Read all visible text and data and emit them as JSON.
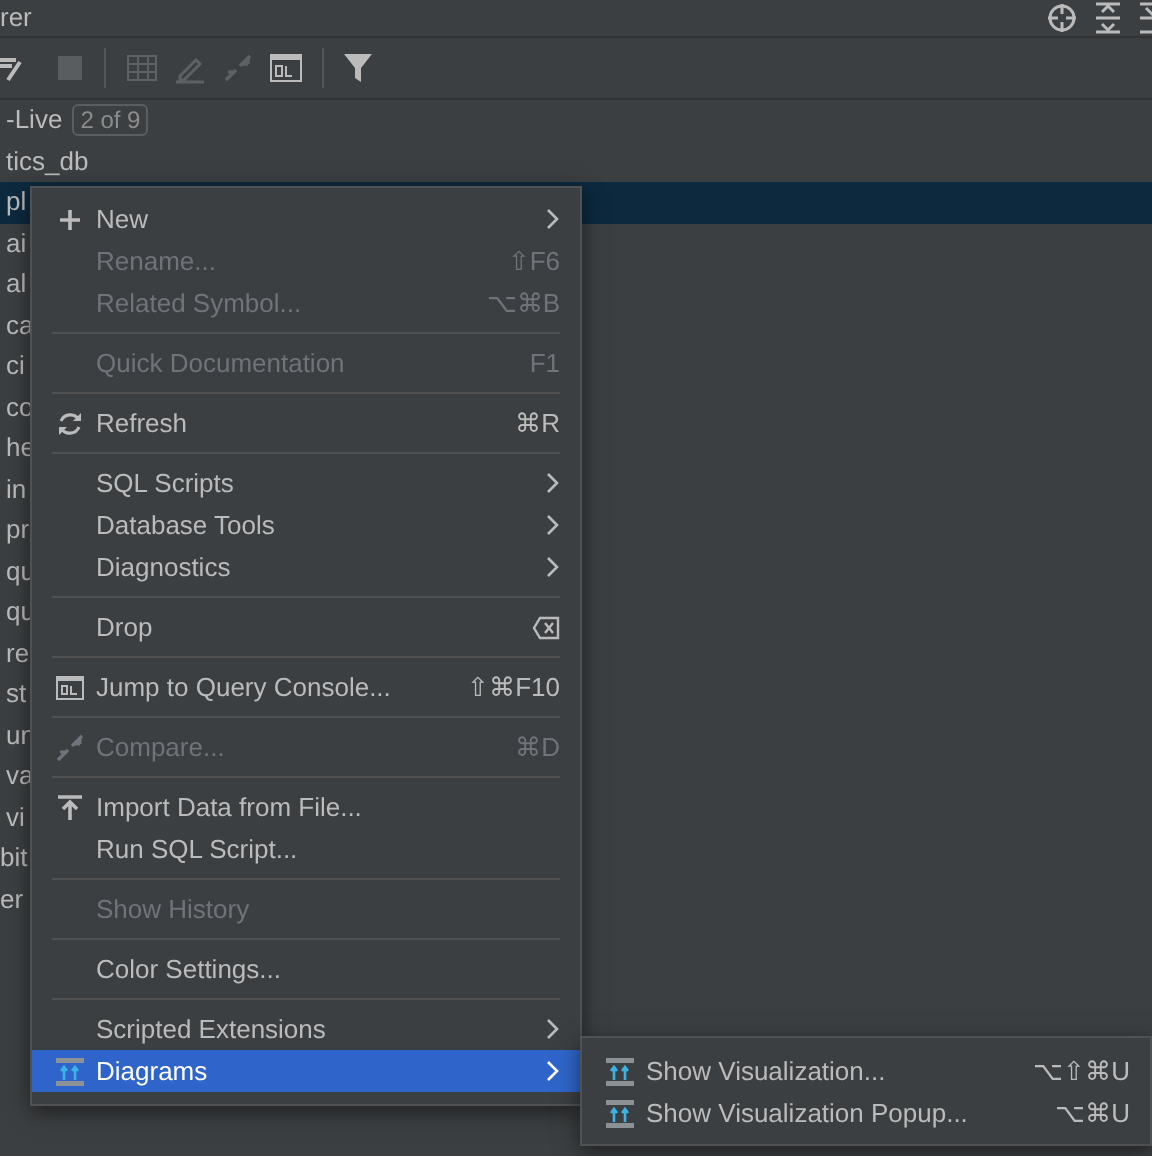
{
  "panel": {
    "title": "rer"
  },
  "tree": [
    {
      "label": "-Live",
      "badge": "2 of 9",
      "selected": false
    },
    {
      "label": "tics_db",
      "selected": false
    },
    {
      "label": "pl",
      "selected": true
    },
    {
      "label": "ai",
      "selected": false
    },
    {
      "label": "al",
      "selected": false
    },
    {
      "label": "ca",
      "selected": false
    },
    {
      "label": "ci",
      "selected": false
    },
    {
      "label": "co",
      "selected": false
    },
    {
      "label": "he",
      "selected": false
    },
    {
      "label": "in",
      "selected": false
    },
    {
      "label": "pr",
      "selected": false
    },
    {
      "label": "qu",
      "selected": false
    },
    {
      "label": "qu",
      "selected": false
    },
    {
      "label": "re",
      "selected": false
    },
    {
      "label": "st",
      "selected": false
    },
    {
      "label": "un",
      "selected": false
    },
    {
      "label": "va",
      "selected": false
    },
    {
      "label": "vi",
      "selected": false
    },
    {
      "label": "bit",
      "selected": false
    },
    {
      "label": "er",
      "selected": false
    }
  ],
  "context_menu": [
    {
      "kind": "item",
      "label": "New",
      "submenu": true,
      "disabled": false,
      "selected": false
    },
    {
      "kind": "item",
      "label": "Rename...",
      "shortcut": "⇧F6",
      "disabled": true,
      "selected": false
    },
    {
      "kind": "item",
      "label": "Related Symbol...",
      "shortcut": "⌥⌘B",
      "disabled": true,
      "selected": false
    },
    {
      "kind": "separator"
    },
    {
      "kind": "item",
      "label": "Quick Documentation",
      "shortcut": "F1",
      "disabled": true,
      "selected": false
    },
    {
      "kind": "separator"
    },
    {
      "kind": "item",
      "label": "Refresh",
      "shortcut": "⌘R",
      "disabled": false,
      "selected": false
    },
    {
      "kind": "separator"
    },
    {
      "kind": "item",
      "label": "SQL Scripts",
      "submenu": true,
      "disabled": false,
      "selected": false
    },
    {
      "kind": "item",
      "label": "Database Tools",
      "submenu": true,
      "disabled": false,
      "selected": false
    },
    {
      "kind": "item",
      "label": "Diagnostics",
      "submenu": true,
      "disabled": false,
      "selected": false
    },
    {
      "kind": "separator"
    },
    {
      "kind": "item",
      "label": "Drop",
      "disabled": false,
      "selected": false
    },
    {
      "kind": "separator"
    },
    {
      "kind": "item",
      "label": "Jump to Query Console...",
      "shortcut": "⇧⌘F10",
      "disabled": false,
      "selected": false
    },
    {
      "kind": "separator"
    },
    {
      "kind": "item",
      "label": "Compare...",
      "shortcut": "⌘D",
      "disabled": true,
      "selected": false
    },
    {
      "kind": "separator"
    },
    {
      "kind": "item",
      "label": "Import Data from File...",
      "disabled": false,
      "selected": false
    },
    {
      "kind": "item",
      "label": "Run SQL Script...",
      "disabled": false,
      "selected": false
    },
    {
      "kind": "separator"
    },
    {
      "kind": "item",
      "label": "Show History",
      "disabled": true,
      "selected": false
    },
    {
      "kind": "separator"
    },
    {
      "kind": "item",
      "label": "Color Settings...",
      "disabled": false,
      "selected": false
    },
    {
      "kind": "separator"
    },
    {
      "kind": "item",
      "label": "Scripted Extensions",
      "submenu": true,
      "disabled": false,
      "selected": false
    },
    {
      "kind": "item",
      "label": "Diagrams",
      "submenu": true,
      "disabled": false,
      "selected": true
    }
  ],
  "submenu": [
    {
      "kind": "item",
      "label": "Show Visualization...",
      "shortcut": "⌥⇧⌘U",
      "disabled": false,
      "selected": false
    },
    {
      "kind": "item",
      "label": "Show Visualization Popup...",
      "shortcut": "⌥⌘U",
      "disabled": false,
      "selected": false
    }
  ]
}
